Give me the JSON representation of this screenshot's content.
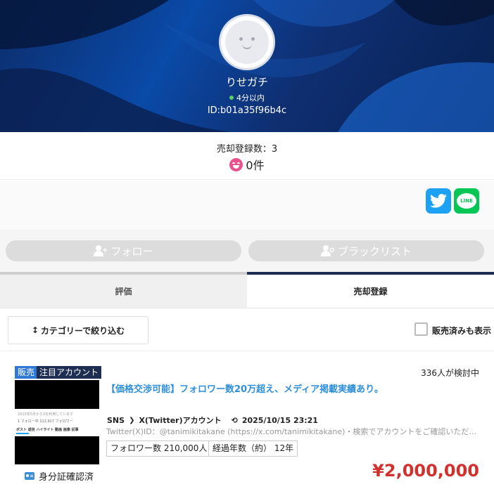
{
  "profile": {
    "username": "りせガチ",
    "online_status": "4分以内",
    "user_id": "ID:b01a35f96b4c"
  },
  "stats": {
    "sales_count_label": "売却登録数：3",
    "rating_count": "0件"
  },
  "share": {
    "line_label": "LINE"
  },
  "actions": {
    "follow_label": "フォロー",
    "blacklist_label": "ブラックリスト"
  },
  "tabs": [
    {
      "label": "評価",
      "active": false
    },
    {
      "label": "売却登録",
      "active": true
    }
  ],
  "filter": {
    "category_button_label": "カテゴリーで絞り込む",
    "show_sold_label": "販売済みも表示",
    "show_sold_checked": false
  },
  "listing": {
    "badges": [
      "販売",
      "注目アカウント"
    ],
    "viewers": "336人が検討中",
    "title": "【価格交渉可能】フォロワー数20万超え、メディア掲載実績あり。",
    "category": "SNS",
    "subcategory": "X(Twitter)アカウント",
    "date": "2025/10/15 23:21",
    "description": "Twitter(X)ID：@tanimikitakane (https://x.com/tanimikitakane)・検索でアカウントをご確認いただくことが…",
    "followers_tag": "フォロワー数  210,000人",
    "years_tag": "経過年数（約）  12年",
    "verified_label": "身分証確認済",
    "price": "¥2,000,000",
    "thumbnail": {
      "line1": "2013年5月からXを利用しています",
      "line2": "1 フォロー中  212,917 フォロワー",
      "tabs": "ポスト  返信  ハイライト  動画  画像  記事"
    }
  },
  "colors": {
    "hero_dark": "#0c2d6b",
    "accent_blue": "#2f8fd8",
    "price_red": "#d0312d",
    "twitter": "#1da1f2",
    "line": "#06c755",
    "tab_active": "#1e2d52"
  }
}
